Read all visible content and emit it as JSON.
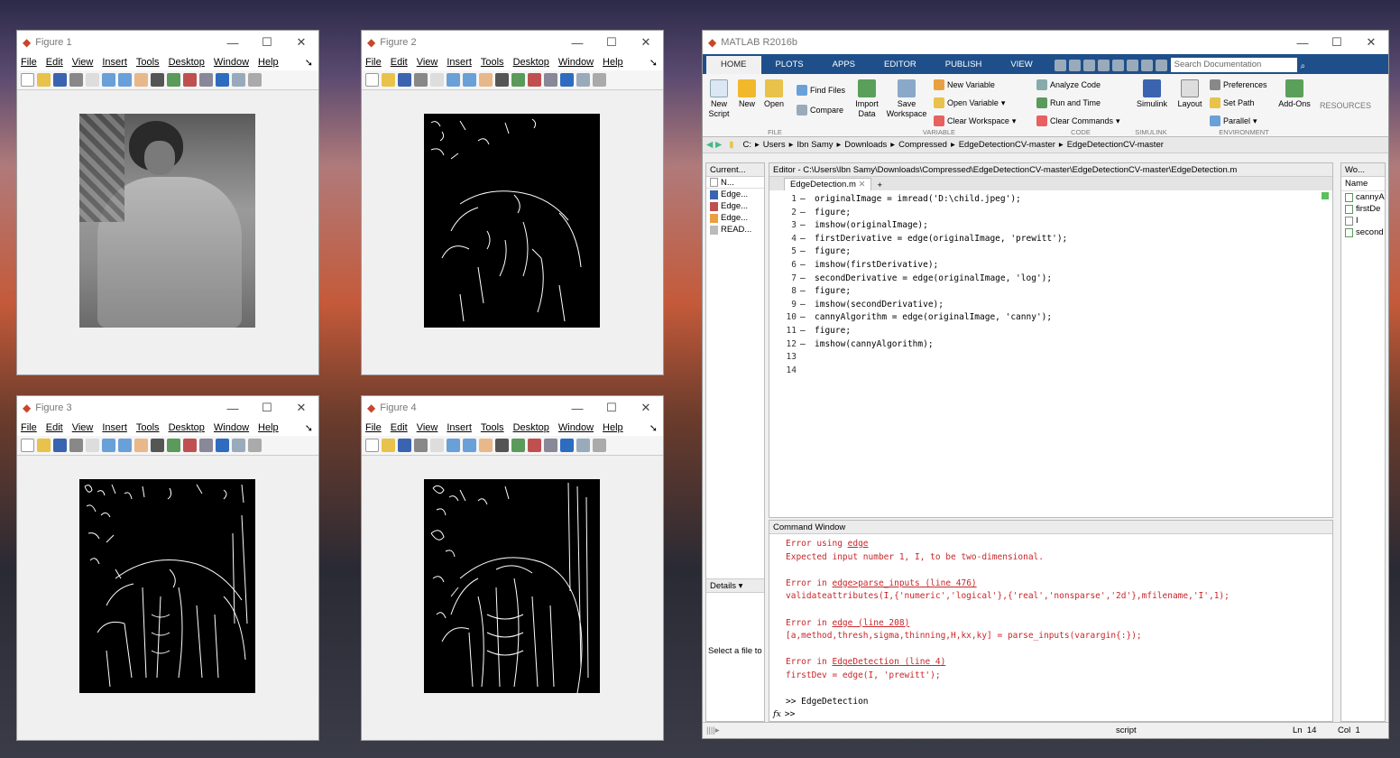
{
  "figures": [
    {
      "title": "Figure 1"
    },
    {
      "title": "Figure 2"
    },
    {
      "title": "Figure 3"
    },
    {
      "title": "Figure 4"
    }
  ],
  "figure_menu": [
    "File",
    "Edit",
    "View",
    "Insert",
    "Tools",
    "Desktop",
    "Window",
    "Help"
  ],
  "window_controls": {
    "minimize": "—",
    "maximize": "☐",
    "close": "✕"
  },
  "matlab": {
    "title": "MATLAB R2016b",
    "tabs": [
      "HOME",
      "PLOTS",
      "APPS",
      "EDITOR",
      "PUBLISH",
      "VIEW"
    ],
    "search_placeholder": "Search Documentation",
    "ribbon": {
      "new_script": "New Script",
      "new": "New",
      "open": "Open",
      "find_files": "Find Files",
      "compare": "Compare",
      "import_data": "Import Data",
      "save_workspace": "Save Workspace",
      "new_variable": "New Variable",
      "open_variable": "Open Variable",
      "clear_workspace": "Clear Workspace",
      "analyze_code": "Analyze Code",
      "run_and_time": "Run and Time",
      "clear_commands": "Clear Commands",
      "simulink": "Simulink",
      "layout": "Layout",
      "preferences": "Preferences",
      "set_path": "Set Path",
      "parallel": "Parallel",
      "add_ons": "Add-Ons",
      "resources": "RESOURCES",
      "sections": [
        "FILE",
        "VARIABLE",
        "CODE",
        "SIMULINK",
        "ENVIRONMENT"
      ]
    },
    "path": [
      "C:",
      "Users",
      "Ibn Samy",
      "Downloads",
      "Compressed",
      "EdgeDetectionCV-master",
      "EdgeDetectionCV-master"
    ],
    "current_folder": {
      "header": "Current...",
      "col": "N...",
      "files": [
        "Edge...",
        "Edge...",
        "Edge...",
        "READ..."
      ],
      "details": "Details",
      "select_hint": "Select a file to"
    },
    "editor": {
      "header": "Editor - C:\\Users\\Ibn Samy\\Downloads\\Compressed\\EdgeDetectionCV-master\\EdgeDetectionCV-master\\EdgeDetection.m",
      "tab": "EdgeDetection.m",
      "lines": [
        "originalImage = imread('D:\\child.jpeg');",
        "figure;",
        "imshow(originalImage);",
        "firstDerivative = edge(originalImage, 'prewitt');",
        "figure;",
        "imshow(firstDerivative);",
        "secondDerivative = edge(originalImage, 'log');",
        "figure;",
        "imshow(secondDerivative);",
        "cannyAlgorithm = edge(originalImage, 'canny');",
        "figure;",
        "imshow(cannyAlgorithm);",
        "",
        ""
      ]
    },
    "workspace": {
      "header": "Wo...",
      "col": "Name",
      "vars": [
        "cannyA",
        "firstDe",
        "I",
        "second"
      ]
    },
    "command_window": {
      "header": "Command Window",
      "lines": [
        {
          "t": "err",
          "pre": "Error using ",
          "link": "edge",
          "post": ""
        },
        {
          "t": "err",
          "pre": "Expected input number 1, I, to be two-dimensional.",
          "link": "",
          "post": ""
        },
        {
          "t": "blank",
          "pre": "",
          "link": "",
          "post": ""
        },
        {
          "t": "err",
          "pre": "Error in ",
          "link": "edge>parse_inputs",
          "post": " (line 476)"
        },
        {
          "t": "err",
          "pre": "validateattributes(I,{'numeric','logical'},{'real','nonsparse','2d'},mfilename,'I',1);",
          "link": "",
          "post": ""
        },
        {
          "t": "blank",
          "pre": "",
          "link": "",
          "post": ""
        },
        {
          "t": "err",
          "pre": "Error in ",
          "link": "edge",
          "post": " (line 208)"
        },
        {
          "t": "err",
          "pre": "[a,method,thresh,sigma,thinning,H,kx,ky] = parse_inputs(varargin{:});",
          "link": "",
          "post": ""
        },
        {
          "t": "blank",
          "pre": "",
          "link": "",
          "post": ""
        },
        {
          "t": "err",
          "pre": "Error in ",
          "link": "EdgeDetection",
          "post": " (line 4)"
        },
        {
          "t": "err",
          "pre": "firstDev = edge(I, 'prewitt');",
          "link": "",
          "post": ""
        },
        {
          "t": "blank",
          "pre": "",
          "link": "",
          "post": ""
        },
        {
          "t": "norm",
          "pre": ">> EdgeDetection",
          "link": "",
          "post": ""
        }
      ],
      "prompt": ">>",
      "fx": "fx"
    },
    "status": {
      "mode": "script",
      "ln": "Ln  14",
      "col": "Col  1"
    }
  }
}
